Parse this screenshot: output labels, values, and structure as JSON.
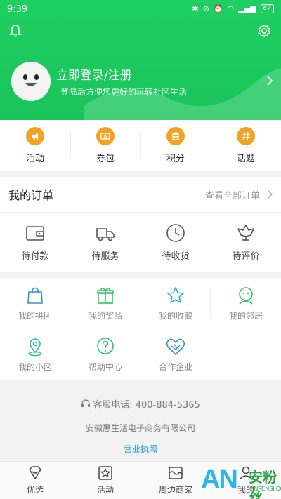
{
  "statusbar": {
    "time": "9:39",
    "battery": "67"
  },
  "header": {
    "login_title": "立即登录/注册",
    "login_subtitle": "登陆后方便您更好的玩转社区生活"
  },
  "quick_menu": [
    {
      "label": "活动",
      "icon": "megaphone-icon"
    },
    {
      "label": "券包",
      "icon": "ticket-icon"
    },
    {
      "label": "积分",
      "icon": "coins-icon"
    },
    {
      "label": "话题",
      "icon": "hash-icon"
    }
  ],
  "orders": {
    "title": "我的订单",
    "view_all": "查看全部订单",
    "items": [
      {
        "label": "待付款",
        "icon": "wallet-icon"
      },
      {
        "label": "待服务",
        "icon": "truck-icon"
      },
      {
        "label": "待收货",
        "icon": "clock-icon"
      },
      {
        "label": "待评价",
        "icon": "flower-icon"
      }
    ]
  },
  "services": [
    {
      "label": "我的拼团",
      "icon": "shopping-bag-icon"
    },
    {
      "label": "我的奖品",
      "icon": "gift-icon"
    },
    {
      "label": "我的收藏",
      "icon": "star-icon"
    },
    {
      "label": "我的邻居",
      "icon": "neighbor-icon"
    },
    {
      "label": "我的小区",
      "icon": "location-pin-icon"
    },
    {
      "label": "帮助中心",
      "icon": "help-icon"
    },
    {
      "label": "合作企业",
      "icon": "handshake-icon"
    }
  ],
  "info": {
    "phone": "客服电话: 400-884-5365",
    "company": "安徽惠生活电子商务有限公司",
    "license": "营业执照"
  },
  "tabbar": [
    {
      "label": "优选",
      "icon": "diamond-icon"
    },
    {
      "label": "活动",
      "icon": "activity-icon"
    },
    {
      "label": "周边商家",
      "icon": "shop-icon"
    },
    {
      "label": "我的",
      "icon": "user-icon"
    }
  ],
  "watermark": {
    "brand": "AN",
    "name": "安粉丝",
    "url": "ANFENSI.COM"
  },
  "colors": {
    "primary": "#1fcf62",
    "accent": "#f4a223",
    "link": "#2c9ec9",
    "service_icon": "#3fbf9a"
  }
}
